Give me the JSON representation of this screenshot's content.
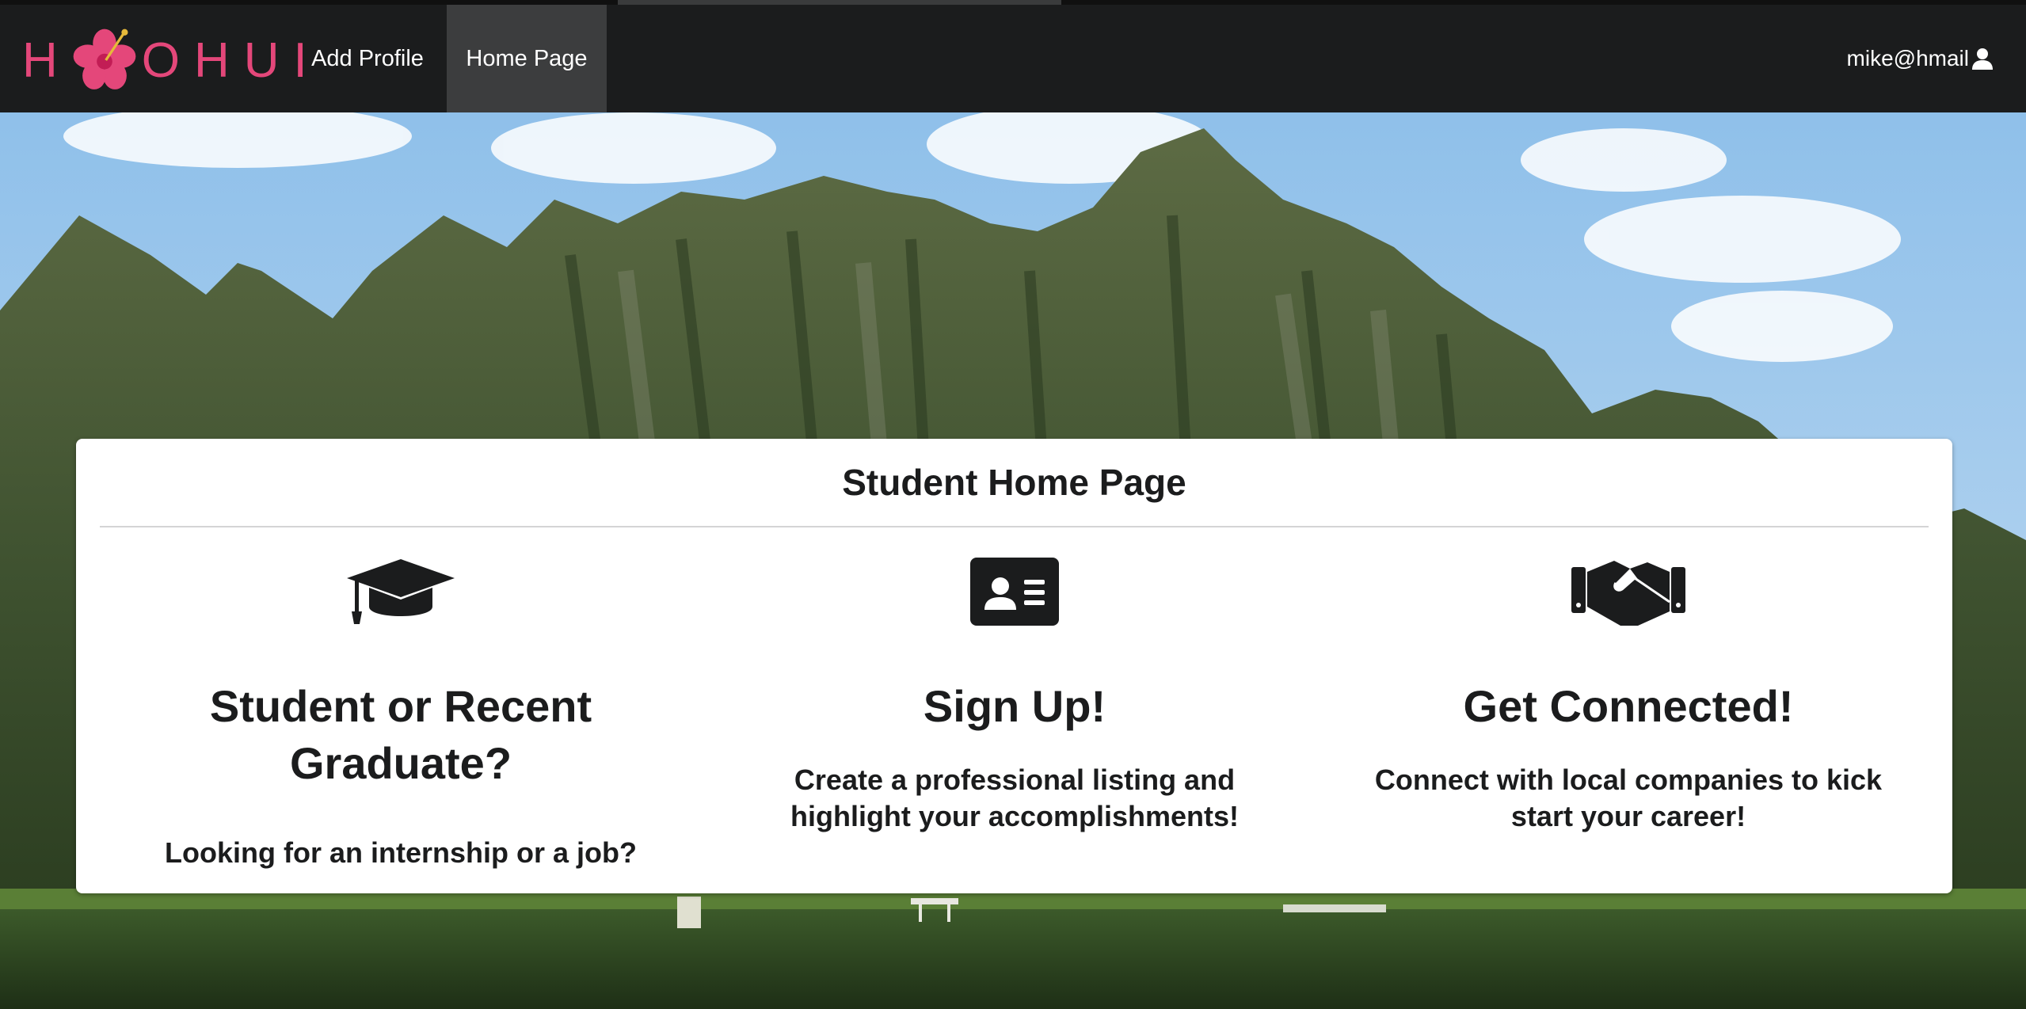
{
  "navbar": {
    "logo_text": "HOHUI",
    "add_profile": "Add Profile",
    "home_page": "Home Page",
    "user": "mike@hmail"
  },
  "colors": {
    "navbar": "#1b1c1d",
    "active_tab": "#3c3d3e",
    "logo_pink": "#e4477a",
    "card": "#ffffff",
    "text": "#1b1c1d"
  },
  "card": {
    "title": "Student Home Page",
    "columns": [
      {
        "icon": "graduation-cap-icon",
        "heading": "Student or Recent Graduate?",
        "text": "Looking for an internship or a job?"
      },
      {
        "icon": "id-card-icon",
        "heading": "Sign Up!",
        "text": "Create a professional listing and highlight your accomplishments!"
      },
      {
        "icon": "handshake-icon",
        "heading": "Get Connected!",
        "text": "Connect with local companies to kick start your career!"
      }
    ]
  }
}
